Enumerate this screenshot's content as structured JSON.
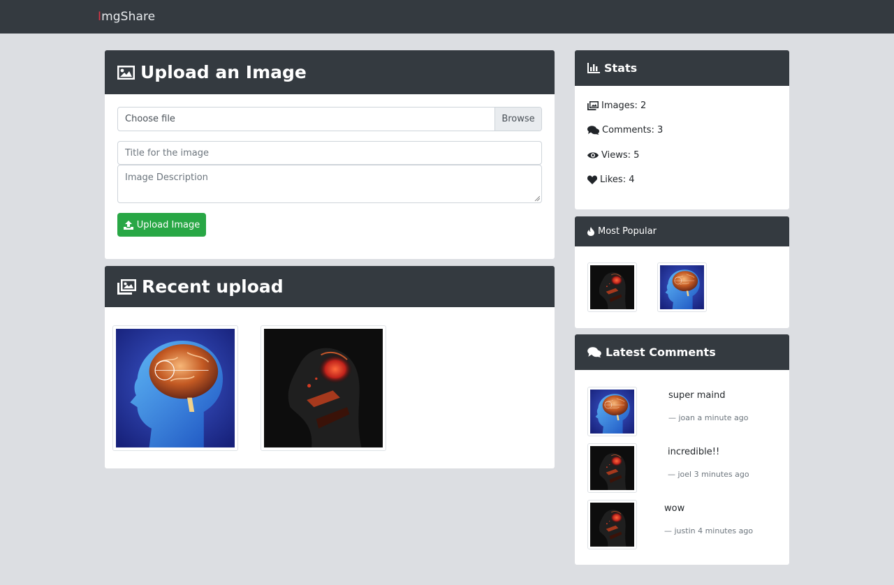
{
  "navbar": {
    "brand_first": "I",
    "brand_rest": "mgShare"
  },
  "upload": {
    "title": "Upload an Image",
    "file_placeholder": "Choose file",
    "browse_label": "Browse",
    "title_placeholder": "Title for the image",
    "description_placeholder": "Image Description",
    "submit_label": "Upload Image"
  },
  "recent": {
    "title": "Recent upload",
    "images": [
      {
        "name": "brain-image"
      },
      {
        "name": "dark-figure-image"
      }
    ]
  },
  "stats": {
    "title": "Stats",
    "items": [
      {
        "icon": "images-icon",
        "label": "Images: 2"
      },
      {
        "icon": "comments-icon",
        "label": "Comments: 3"
      },
      {
        "icon": "eye-icon",
        "label": "Views: 5"
      },
      {
        "icon": "heart-icon",
        "label": "Likes: 4"
      }
    ]
  },
  "popular": {
    "title": "Most Popular",
    "images": [
      {
        "name": "dark-figure-image"
      },
      {
        "name": "brain-image"
      }
    ]
  },
  "comments": {
    "title": "Latest Comments",
    "items": [
      {
        "text": "super maind",
        "meta": "— joan a minute ago",
        "thumb": "brain-image"
      },
      {
        "text": "incredible!!",
        "meta": "— joel 3 minutes ago",
        "thumb": "dark-figure-image"
      },
      {
        "text": "wow",
        "meta": "— justin 4 minutes ago",
        "thumb": "dark-figure-image"
      }
    ]
  },
  "colors": {
    "navbar_bg": "#343a40",
    "page_bg": "#dcdee2",
    "brand_accent": "#dc3545",
    "button_green": "#28a745"
  }
}
